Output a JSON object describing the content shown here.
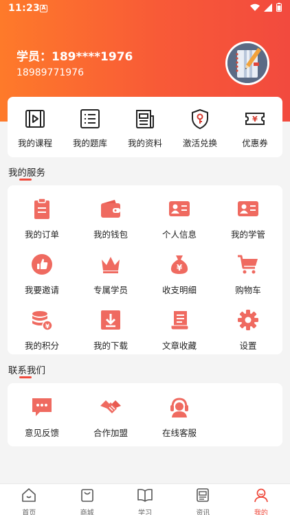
{
  "status_bar": {
    "time": "11:23",
    "sim_glyph": "A"
  },
  "profile": {
    "name": "学员：189****1976",
    "phone": "18989771976"
  },
  "quick_links": [
    {
      "label": "我的课程",
      "icon": "video-play-icon"
    },
    {
      "label": "我的题库",
      "icon": "list-icon"
    },
    {
      "label": "我的资料",
      "icon": "newspaper-icon"
    },
    {
      "label": "激活兑换",
      "icon": "shield-key-icon"
    },
    {
      "label": "优惠券",
      "icon": "coupon-icon"
    }
  ],
  "services": {
    "title": "我的服务",
    "items": [
      {
        "label": "我的订单",
        "icon": "clipboard-icon"
      },
      {
        "label": "我的钱包",
        "icon": "wallet-icon"
      },
      {
        "label": "个人信息",
        "icon": "id-card-icon"
      },
      {
        "label": "我的学管",
        "icon": "id-card-icon"
      },
      {
        "label": "我要邀请",
        "icon": "thumbs-up-icon"
      },
      {
        "label": "专属学员",
        "icon": "crown-icon"
      },
      {
        "label": "收支明细",
        "icon": "money-bag-icon"
      },
      {
        "label": "购物车",
        "icon": "cart-icon"
      },
      {
        "label": "我的积分",
        "icon": "coins-icon"
      },
      {
        "label": "我的下载",
        "icon": "download-icon"
      },
      {
        "label": "文章收藏",
        "icon": "scroll-icon"
      },
      {
        "label": "设置",
        "icon": "gear-icon"
      }
    ]
  },
  "contact": {
    "title": "联系我们",
    "items": [
      {
        "label": "意见反馈",
        "icon": "chat-icon"
      },
      {
        "label": "合作加盟",
        "icon": "handshake-icon"
      },
      {
        "label": "在线客服",
        "icon": "headset-icon"
      }
    ]
  },
  "tabbar": [
    {
      "label": "首页",
      "icon": "home-icon"
    },
    {
      "label": "商城",
      "icon": "shopping-bag-icon"
    },
    {
      "label": "学习",
      "icon": "book-icon"
    },
    {
      "label": "资讯",
      "icon": "news-icon"
    },
    {
      "label": "我的",
      "icon": "user-icon",
      "active": true
    }
  ],
  "colors": {
    "accent": "#ef4a3c",
    "icon_red": "#ef6a60",
    "header_start": "#fe7a2a",
    "header_end": "#f24a3e"
  }
}
